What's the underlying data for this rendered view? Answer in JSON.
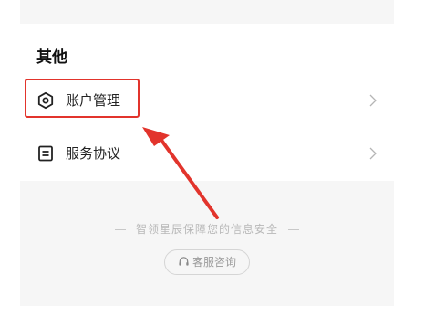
{
  "section": {
    "title": "其他"
  },
  "menu": {
    "items": [
      {
        "label": "账户管理",
        "icon": "hexagon-settings-icon"
      },
      {
        "label": "服务协议",
        "icon": "document-icon"
      }
    ]
  },
  "footer": {
    "security_text": "智领星辰保障您的信息安全",
    "support_button_label": "客服咨询",
    "support_icon": "headset-icon"
  },
  "colors": {
    "highlight": "#e2342c",
    "background": "#f6f6f6",
    "text_primary": "#222222",
    "text_muted": "#b8b8b8"
  }
}
